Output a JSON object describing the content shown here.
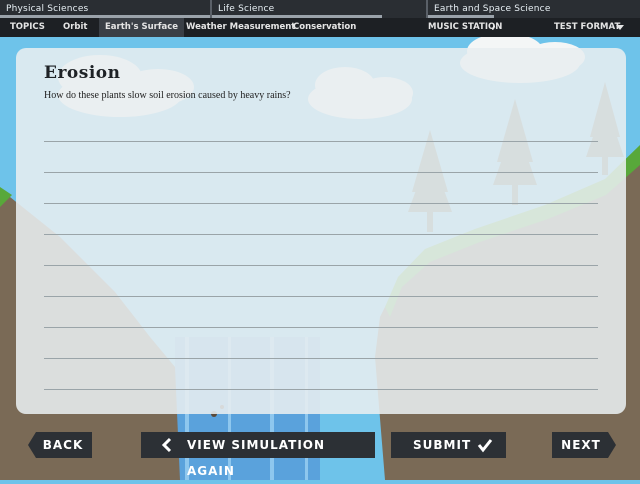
{
  "subject_tabs": [
    "Physical Sciences",
    "Life Science",
    "Earth and Space Science"
  ],
  "nav": {
    "topics": "TOPICS",
    "orbit": "Orbit",
    "earths_surface": "Earth's Surface",
    "weather": "Weather Measurement",
    "conservation": "Conservation",
    "music_station": "MUSIC STATION",
    "test_format": "TEST FORMAT"
  },
  "card": {
    "title": "Erosion",
    "question": "How do these plants slow soil erosion caused by heavy rains?",
    "answer": ""
  },
  "buttons": {
    "back": "BACK",
    "view_simulation": "VIEW SIMULATION AGAIN",
    "submit": "SUBMIT",
    "next": "NEXT"
  },
  "icons": {
    "music": "music-note-icon",
    "test_format_dropdown": "chevron-down-icon",
    "view_simulation": "chevron-left-icon",
    "submit": "checkmark-icon"
  },
  "colors": {
    "sky": "#6ec3ea",
    "cliff": "#7a6a56",
    "grass": "#58a83a",
    "tree": "#5e6b5a",
    "waterfall": "#5aa2dc",
    "button": "#2c3035",
    "card": "#e8eef0"
  }
}
